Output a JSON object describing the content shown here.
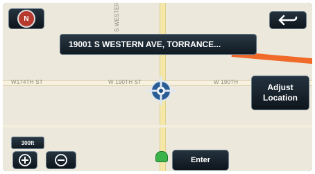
{
  "header": {
    "address": "19001 S WESTERN AVE, TORRANCE..."
  },
  "streets": {
    "west_left": "W174TH ST",
    "west_center": "W 190TH ST",
    "west_right": "W 190TH",
    "vertical": "S WESTERN AVE"
  },
  "buttons": {
    "adjust_line1": "Adjust",
    "adjust_line2": "Location",
    "enter": "Enter",
    "zoom_scale": "300ft"
  },
  "icons": {
    "compass": "compass-icon",
    "back": "back-arrow-icon",
    "zoom_in": "plus-icon",
    "zoom_out": "minus-icon",
    "cursor": "crosshair-cursor-icon",
    "destination": "destination-marker-icon"
  },
  "colors": {
    "route": "#f06a2a",
    "accent": "#1f4f86",
    "background_map": "#ece8dc"
  }
}
